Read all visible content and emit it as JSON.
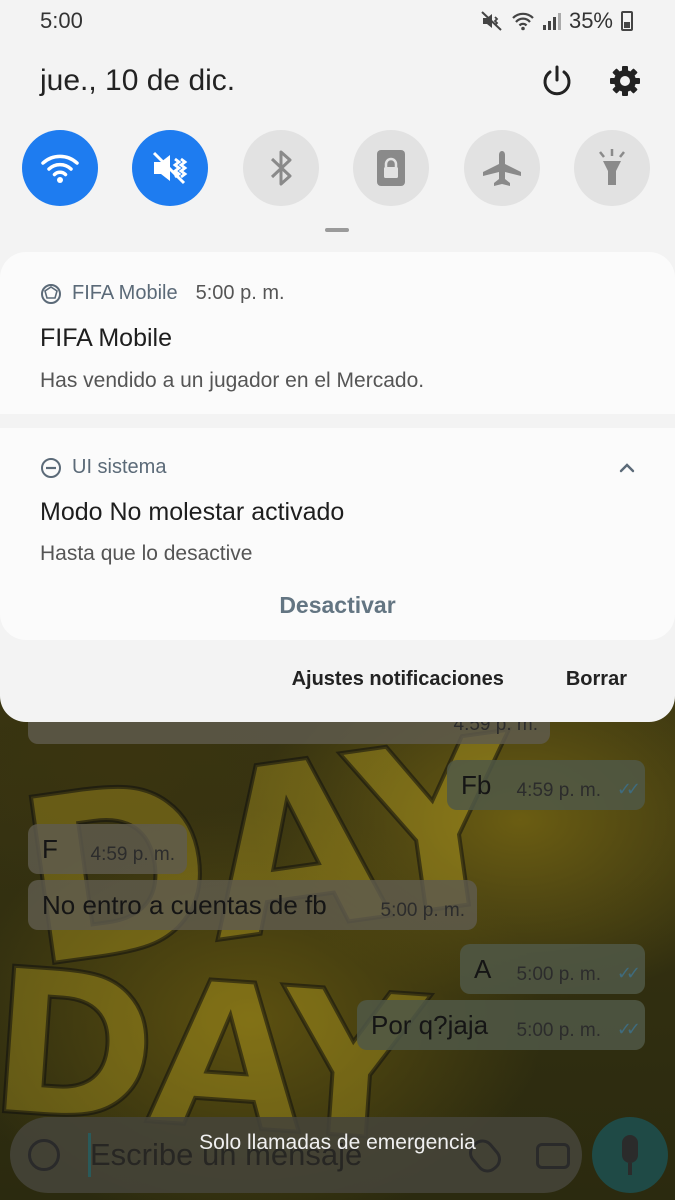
{
  "status_bar": {
    "time": "5:00",
    "battery": "35%"
  },
  "header": {
    "date": "jue., 10 de dic."
  },
  "quick_settings": [
    {
      "name": "wifi",
      "state": "on"
    },
    {
      "name": "mute",
      "state": "on"
    },
    {
      "name": "bluetooth",
      "state": "off"
    },
    {
      "name": "lock-rotation",
      "state": "off"
    },
    {
      "name": "airplane",
      "state": "off"
    },
    {
      "name": "flashlight",
      "state": "off"
    }
  ],
  "notifications": {
    "fifa": {
      "app": "FIFA Mobile",
      "time": "5:00 p. m.",
      "title": "FIFA Mobile",
      "body": "Has vendido a un jugador en el Mercado."
    },
    "dnd": {
      "app": "UI sistema",
      "title": "Modo No molestar activado",
      "body": "Hasta que lo desactive",
      "action": "Desactivar"
    }
  },
  "footer": {
    "settings": "Ajustes notificaciones",
    "clear": "Borrar"
  },
  "chat": {
    "partial_time": "4:59 p. m.",
    "messages": [
      {
        "dir": "out",
        "text": "Fb",
        "time": "4:59 p. m."
      },
      {
        "dir": "in",
        "text": "F",
        "time": "4:59 p. m."
      },
      {
        "dir": "in",
        "text": "No entro a cuentas de fb",
        "time": "5:00 p. m."
      },
      {
        "dir": "out",
        "text": "A",
        "time": "5:00 p. m."
      },
      {
        "dir": "out",
        "text": "Por q?jaja",
        "time": "5:00 p. m."
      }
    ],
    "composer_placeholder": "Escribe un mensaje"
  },
  "emergency_text": "Solo llamadas de emergencia",
  "colors": {
    "accent": "#1e7cf0",
    "shade_bg": "#f3f3f3",
    "action": "#637582"
  }
}
